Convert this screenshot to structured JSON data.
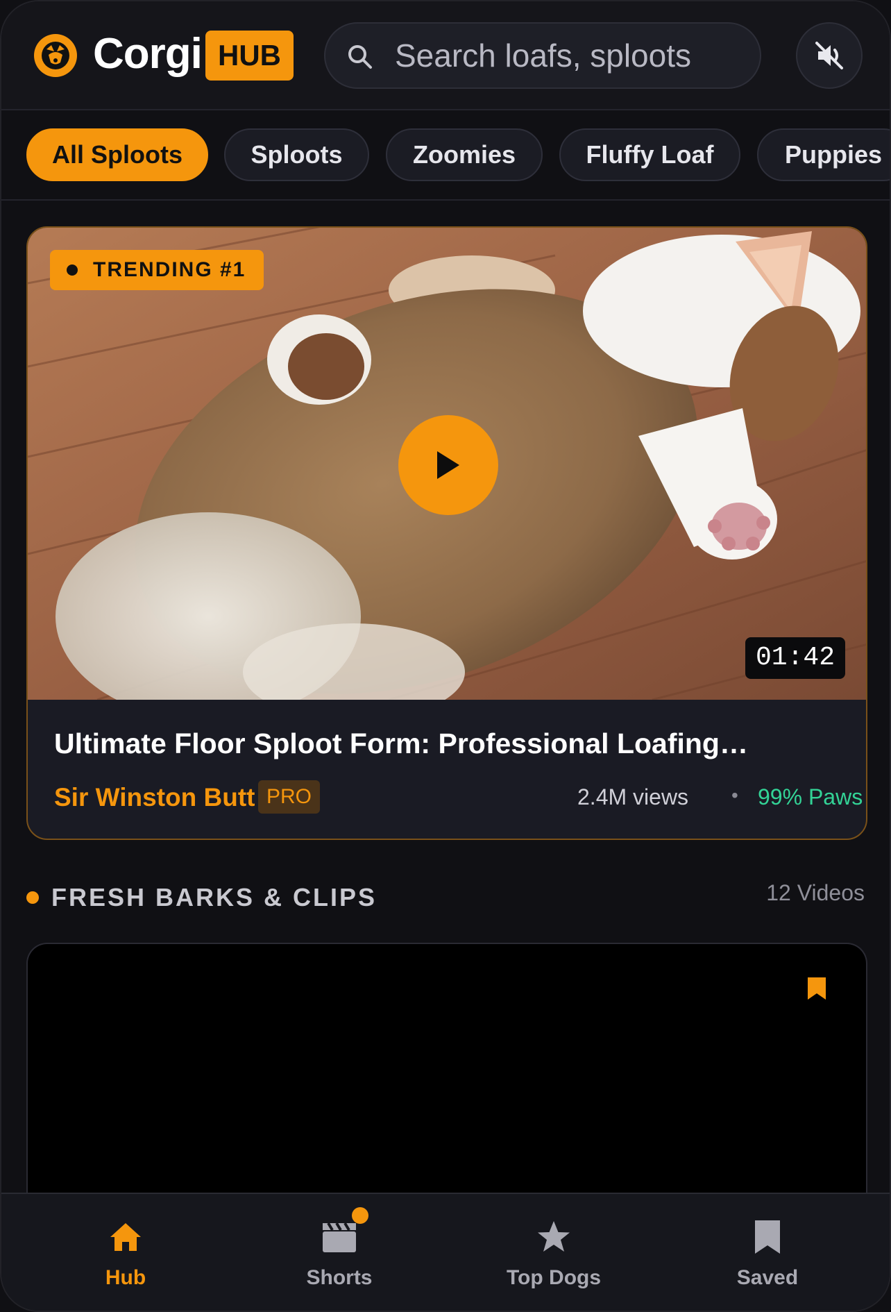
{
  "header": {
    "logo_text": "Corgi",
    "logo_badge": "HUB",
    "search_placeholder": "Search loafs, sploots",
    "mute_icon": "muted-speaker-icon"
  },
  "chips": [
    {
      "label": "All Sploots",
      "active": true
    },
    {
      "label": "Sploots",
      "active": false
    },
    {
      "label": "Zoomies",
      "active": false
    },
    {
      "label": "Fluffy Loaf",
      "active": false
    },
    {
      "label": "Puppies",
      "active": false
    }
  ],
  "featured": {
    "badge": "TRENDING #1",
    "duration": "01:42",
    "title": "Ultimate Floor Sploot Form: Professional Loafing…",
    "author": "Sir Winston Butt",
    "author_badge": "PRO",
    "views": "2.4M views",
    "separator": "•",
    "rating": "99% Paws"
  },
  "section": {
    "title": "FRESH BARKS & CLIPS",
    "count": "12 Videos"
  },
  "bottom_nav": [
    {
      "label": "Hub",
      "icon": "home-icon",
      "active": true
    },
    {
      "label": "Shorts",
      "icon": "clapperboard-icon",
      "active": false
    },
    {
      "label": "Top Dogs",
      "icon": "star-icon",
      "active": false
    },
    {
      "label": "Saved",
      "icon": "bookmark-icon",
      "active": false
    }
  ],
  "colors": {
    "accent": "#f5960d",
    "rating": "#33d396",
    "background": "#101014"
  }
}
